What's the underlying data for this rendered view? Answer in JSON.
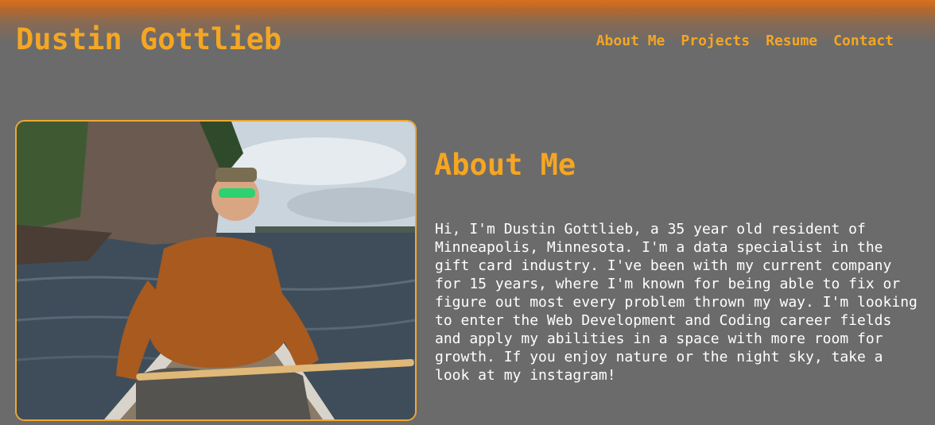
{
  "header": {
    "site_title": "Dustin Gottlieb",
    "nav": [
      {
        "label": "About Me"
      },
      {
        "label": "Projects"
      },
      {
        "label": "Resume"
      },
      {
        "label": "Contact"
      }
    ]
  },
  "about": {
    "heading": "About Me",
    "body": "Hi, I'm Dustin Gottlieb, a 35 year old resident of Minneapolis, Minnesota. I'm a data specialist in the gift card industry. I've been with my current company for 15 years, where I'm known for being able to fix or figure out most every problem thrown my way. I'm looking to enter the Web Development and Coding career fields and apply my abilities in a space with more room for growth. If you enjoy nature or the night sky, take a look at my instagram!"
  },
  "colors": {
    "accent": "#f5a623",
    "background": "#6b6b6b",
    "header_gradient_top": "#d96f20",
    "text": "#ffffff"
  }
}
